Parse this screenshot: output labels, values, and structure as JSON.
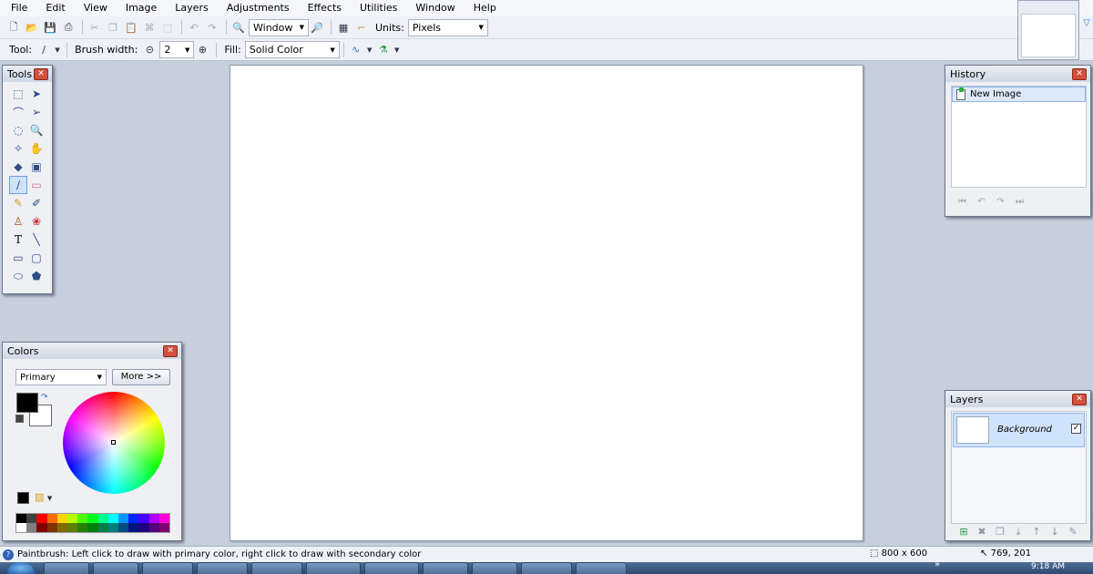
{
  "menu": [
    "File",
    "Edit",
    "View",
    "Image",
    "Layers",
    "Adjustments",
    "Effects",
    "Utilities",
    "Window",
    "Help"
  ],
  "toolbar": {
    "zoom_mode": "Window",
    "units_label": "Units:",
    "units_value": "Pixels",
    "tool_label": "Tool:",
    "brush_width_label": "Brush width:",
    "brush_width_value": "2",
    "fill_label": "Fill:",
    "fill_value": "Solid Color"
  },
  "tools_window": {
    "title": "Tools",
    "tools": [
      "rectangle-select",
      "move-selected-pixels",
      "lasso-select",
      "move-selection",
      "ellipse-select",
      "zoom",
      "magic-wand",
      "pan",
      "paint-bucket",
      "gradient",
      "paintbrush",
      "eraser",
      "pencil",
      "color-picker",
      "clone-stamp",
      "recolor",
      "text",
      "line-curve",
      "rectangle",
      "rounded-rectangle",
      "ellipse",
      "freeform-shape"
    ],
    "selected": "paintbrush"
  },
  "history_window": {
    "title": "History",
    "items": [
      "New Image"
    ]
  },
  "colors_window": {
    "title": "Colors",
    "mode": "Primary",
    "more_label": "More >>",
    "primary_color": "#000000",
    "secondary_color": "#ffffff",
    "palette": [
      "#000000",
      "#404040",
      "#ff0000",
      "#ff6a00",
      "#ffd800",
      "#b6ff00",
      "#4cff00",
      "#00ff21",
      "#00ff90",
      "#00ffff",
      "#0094ff",
      "#0026ff",
      "#4800ff",
      "#b200ff",
      "#ff00dc",
      "#ffffff",
      "#808080",
      "#7f0000",
      "#7f3300",
      "#7f6a00",
      "#5b7f00",
      "#267f00",
      "#007f0e",
      "#007f46",
      "#007f7f",
      "#004a7f",
      "#00137f",
      "#21007f",
      "#57007f",
      "#7f006e"
    ]
  },
  "layers_window": {
    "title": "Layers",
    "layers": [
      {
        "name": "Background",
        "visible": true
      }
    ]
  },
  "status": {
    "hint": "Paintbrush: Left click to draw with primary color, right click to draw with secondary color",
    "image_size": "800 x 600",
    "cursor_pos": "769, 201"
  },
  "taskbar": {
    "clock": "9:18 AM"
  }
}
